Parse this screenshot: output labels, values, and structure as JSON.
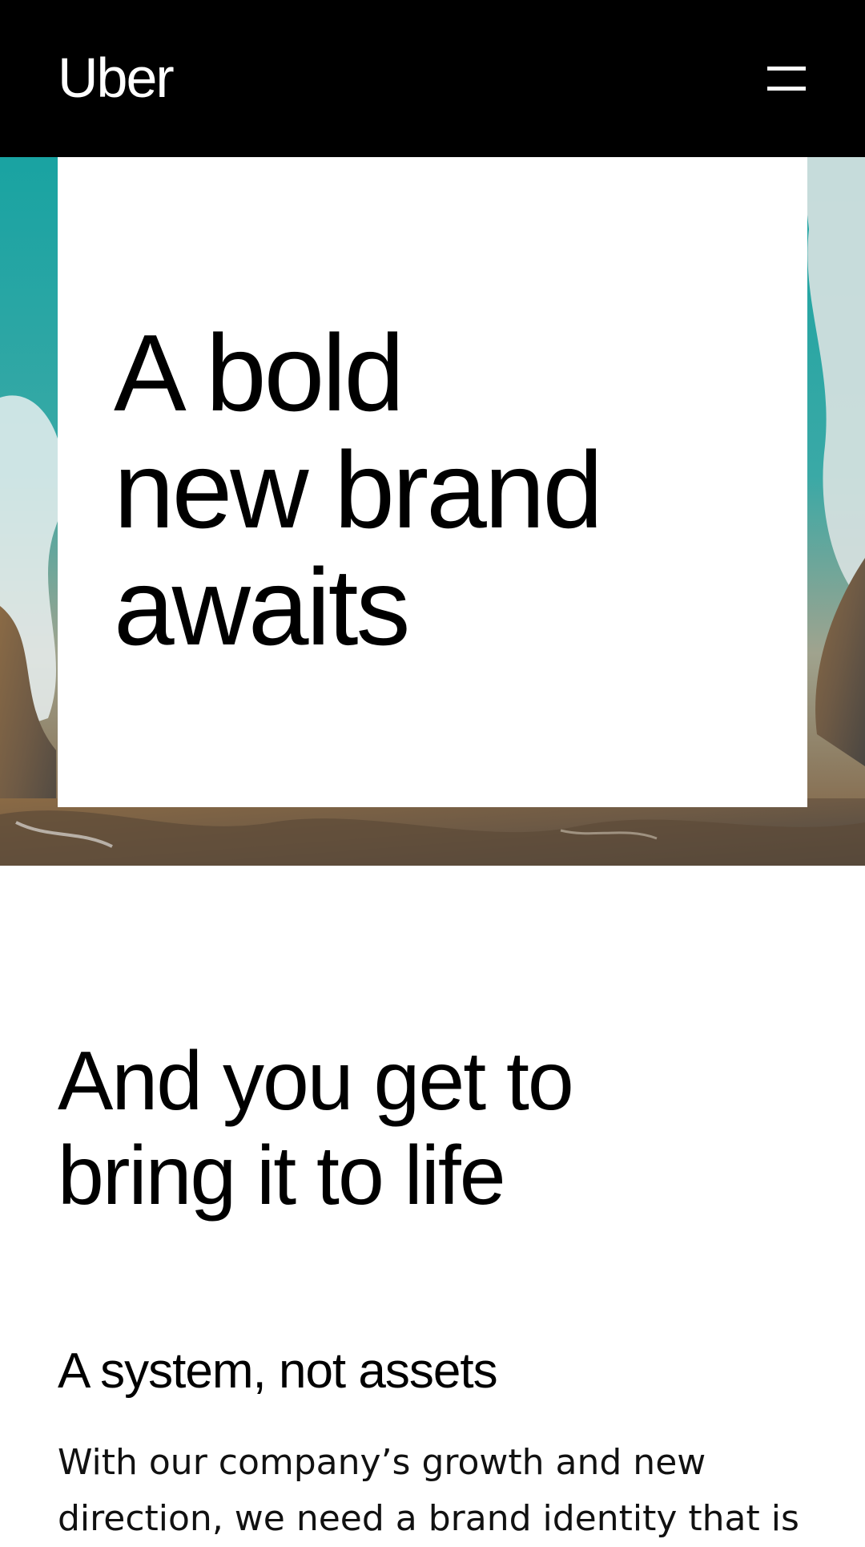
{
  "header": {
    "logo_text": "Uber",
    "menu_icon": "hamburger-menu-icon"
  },
  "hero": {
    "title": "A bold\nnew brand\nawaits",
    "background_colors": [
      "#1f9a9a",
      "#e9ecec",
      "#8a6a45",
      "#4e4a45"
    ]
  },
  "section": {
    "title": "And you get to\nbring it to life",
    "subheading": "A system, not assets",
    "body": "With our company’s growth and new direction, we need a brand identity that is"
  },
  "colors": {
    "header_bg": "#000000",
    "text": "#000000",
    "page_bg": "#ffffff"
  }
}
